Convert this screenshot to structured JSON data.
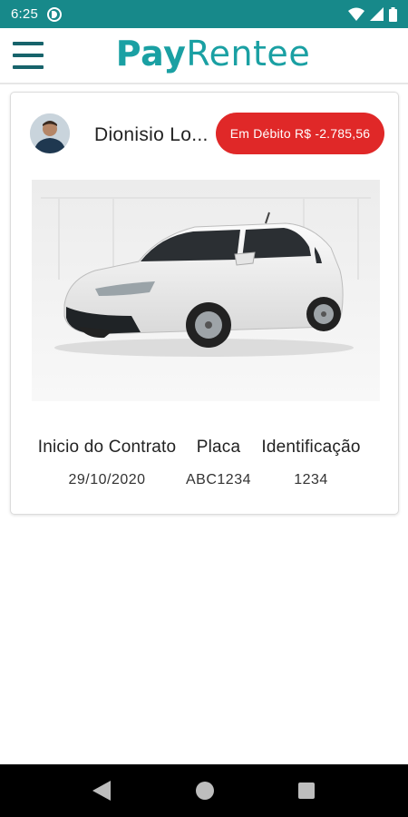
{
  "status_bar": {
    "time": "6:25",
    "icons": [
      "app-notification-icon",
      "wifi-icon",
      "signal-icon",
      "battery-icon"
    ],
    "color": "#17898a"
  },
  "app_bar": {
    "logo_part1": "Pay",
    "logo_part2": "Rentee",
    "menu_icon": "hamburger-menu-icon",
    "brand_color": "#1aa0a3"
  },
  "vehicle_card": {
    "owner_name": "Dionisio Lo...",
    "debt_badge": "Em Débito R$ -2.785,56",
    "debt_color": "#e02828",
    "columns": [
      {
        "label": "Inicio do Contrato",
        "value": "29/10/2020"
      },
      {
        "label": "Placa",
        "value": "ABC1234"
      },
      {
        "label": "Identificação",
        "value": "1234"
      }
    ]
  },
  "nav_bar": {
    "icons": [
      "back-icon",
      "home-icon",
      "recents-icon"
    ]
  }
}
